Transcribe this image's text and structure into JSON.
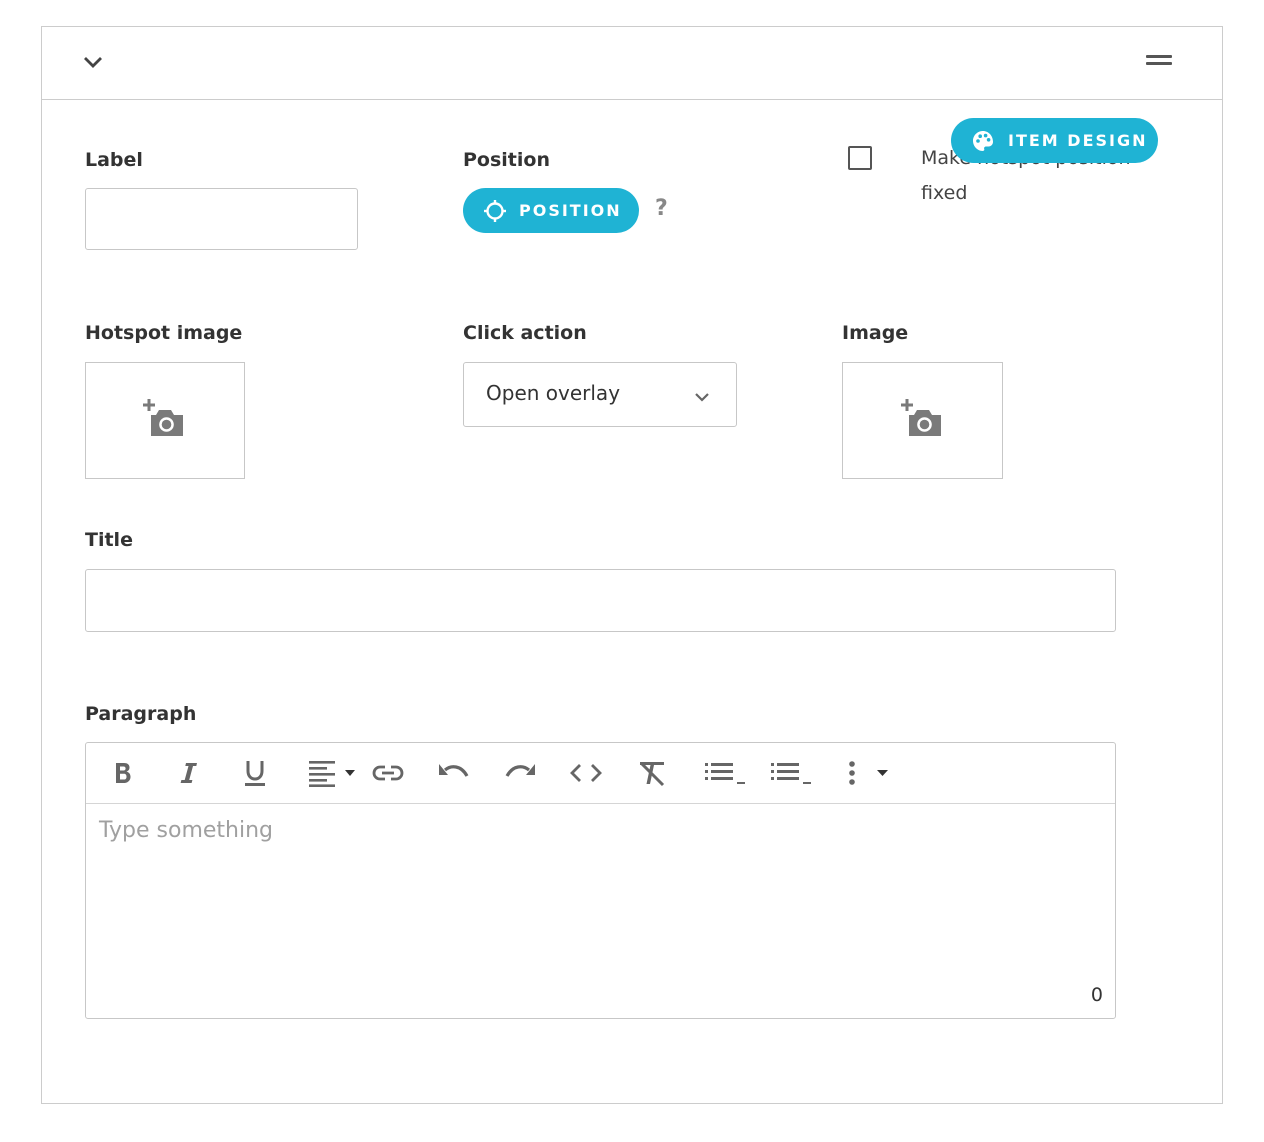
{
  "header": {
    "collapse_icon": "chevron-down-icon",
    "drag_icon": "drag-handle-icon"
  },
  "item_design": {
    "label": "ITEM DESIGN",
    "icon": "palette-icon"
  },
  "label_field": {
    "label": "Label",
    "value": ""
  },
  "position_field": {
    "label": "Position",
    "button_label": "POSITION",
    "button_icon": "crosshair-icon",
    "help": "?"
  },
  "fixed_checkbox": {
    "label": "Make hotspot position fixed",
    "checked": false
  },
  "hotspot_image": {
    "label": "Hotspot image",
    "icon": "add-photo-icon"
  },
  "click_action": {
    "label": "Click action",
    "value": "Open overlay"
  },
  "image_field": {
    "label": "Image",
    "icon": "add-photo-icon"
  },
  "title_field": {
    "label": "Title",
    "value": ""
  },
  "paragraph": {
    "label": "Paragraph",
    "placeholder": "Type something",
    "char_count": "0",
    "toolbar": [
      "bold-icon",
      "italic-icon",
      "underline-icon",
      "align-left-icon",
      "link-icon",
      "undo-icon",
      "redo-icon",
      "code-icon",
      "clear-format-icon",
      "bulleted-list-icon",
      "numbered-list-icon",
      "more-options-icon"
    ]
  },
  "colors": {
    "accent": "#1fb3d4",
    "border": "#c7c7c7",
    "text": "#333333"
  }
}
